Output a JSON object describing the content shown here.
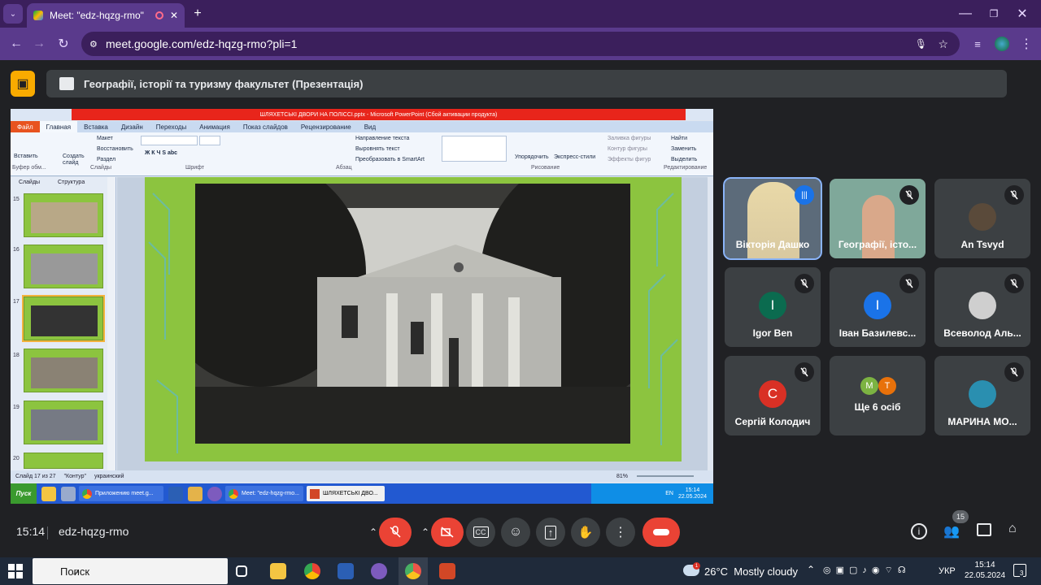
{
  "browser": {
    "tab_title": "Meet: \"edz-hqzg-rmo\"",
    "url": "meet.google.com/edz-hqzg-rmo?pli=1"
  },
  "presentation": {
    "title": "Географії, історії та туризму факультет (Презентація)"
  },
  "ppt": {
    "window_title": "ШЛЯХЕТСЬКІ ДВОРИ НА ПОЛІССІ.pptx - Microsoft PowerPoint (Сбой активации продукта)",
    "tabs": [
      "Файл",
      "Главная",
      "Вставка",
      "Дизайн",
      "Переходы",
      "Анимация",
      "Показ слайдов",
      "Рецензирование",
      "Вид"
    ],
    "ribbon": {
      "insert": "Вставить",
      "create": "Создать слайд",
      "layout": "Макет",
      "restore": "Восстановить",
      "section": "Раздел",
      "text_direction": "Направление текста",
      "align_text": "Выровнять текст",
      "smartart": "Преобразовать в SmartArt",
      "arrange": "Упорядочить",
      "quick_styles": "Экспресс-стили",
      "fill": "Заливка фигуры",
      "outline": "Контур фигуры",
      "effects": "Эффекты фигур",
      "find": "Найти",
      "replace": "Заменить",
      "select": "Выделить",
      "groups": [
        "Буфер обм...",
        "Слайды",
        "Шрифт",
        "Абзац",
        "Рисование",
        "Редактирование"
      ]
    },
    "panel_tabs": [
      "Слайды",
      "Структура"
    ],
    "thumb_numbers": [
      "15",
      "16",
      "17",
      "18",
      "19",
      "20"
    ],
    "status": {
      "slide": "Слайд 17 из 27",
      "theme": "\"Контур\"",
      "lang": "украинский",
      "zoom": "81%"
    }
  },
  "xp_taskbar": {
    "start": "Пуск",
    "buttons": [
      "Приложению meet.g...",
      "Meet: \"edz-hqzg-rmo...",
      "ШЛЯХЕТСЬКІ ДВО..."
    ],
    "lang": "EN",
    "time": "15:14",
    "date": "22.05.2024"
  },
  "participants": [
    {
      "name": "Вікторія Дашко",
      "initial": "",
      "color": "",
      "speaking": true
    },
    {
      "name": "Географії, істо...",
      "initial": "",
      "color": "",
      "speaking": false
    },
    {
      "name": "An Tsvyd",
      "initial": "",
      "color": "#5a4a3a",
      "speaking": false
    },
    {
      "name": "Igor Ben",
      "initial": "I",
      "color": "#0b6b4f",
      "speaking": false
    },
    {
      "name": "Іван Базилевс...",
      "initial": "I",
      "color": "#1a73e8",
      "speaking": false
    },
    {
      "name": "Всеволод Аль...",
      "initial": "",
      "color": "#555555",
      "speaking": false
    },
    {
      "name": "Сергій Колодич",
      "initial": "C",
      "color": "#d93025",
      "speaking": false
    },
    {
      "name": "Ще 6 осіб",
      "initial": "",
      "color": "",
      "speaking": false
    },
    {
      "name": "МАРИНА МО...",
      "initial": "",
      "color": "#2a8fb0",
      "speaking": false
    }
  ],
  "more": {
    "m": "M",
    "t": "T"
  },
  "meeting": {
    "time": "15:14",
    "code": "edz-hqzg-rmo",
    "people_count": "15"
  },
  "windows": {
    "search": "Поиск",
    "weather": "26°C  Mostly cloudy",
    "lang": "УКР",
    "time": "15:14",
    "date": "22.05.2024",
    "notif_badge": "1",
    "notif_count": "3"
  }
}
